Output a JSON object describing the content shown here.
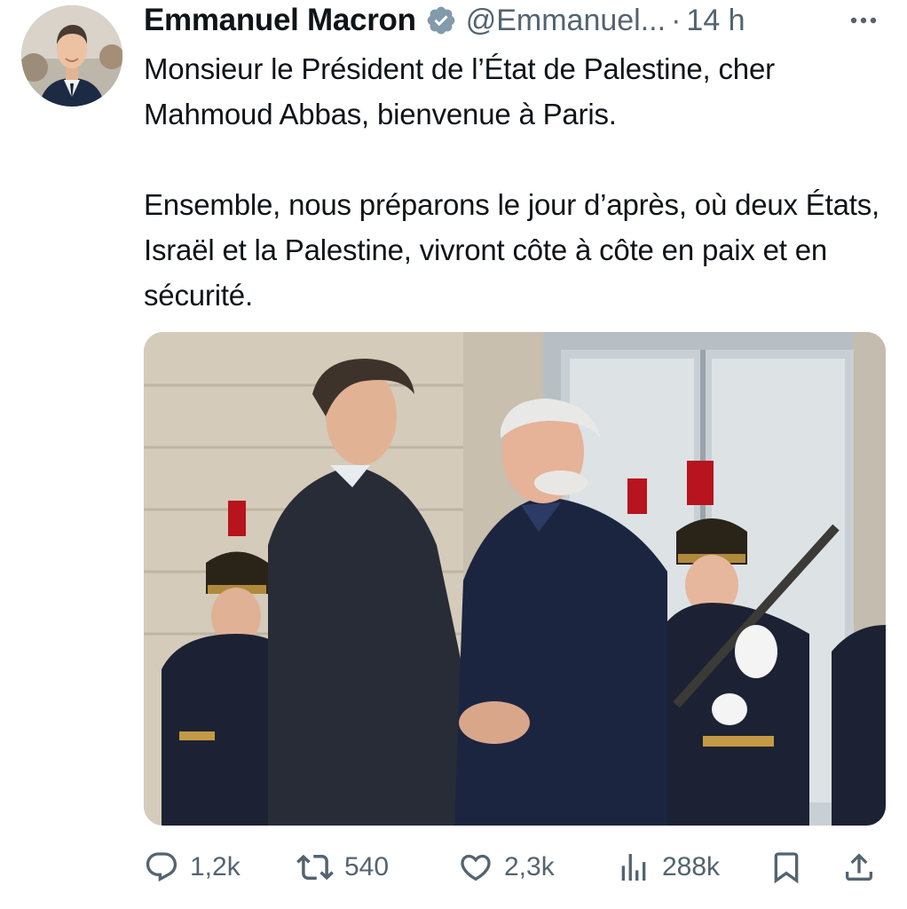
{
  "tweet": {
    "author": {
      "display_name": "Emmanuel Macron",
      "handle": "@Emmanuel...",
      "verified": true
    },
    "separator": "·",
    "time": "14 h",
    "paragraphs": [
      "Monsieur le Président de l’État de Palestine, cher Mahmoud Abbas, bienvenue à Paris.",
      "Ensemble, nous préparons le jour d’après, où deux États, Israël et la Palestine, vivront côte à côte en paix et en sécurité."
    ],
    "actions": {
      "reply_count": "1,2k",
      "retweet_count": "540",
      "like_count": "2,3k",
      "views_count": "288k"
    }
  },
  "icons": {
    "avatar": "avatar",
    "verified": "verified-badge-icon",
    "more": "more-icon",
    "reply": "reply-icon",
    "retweet": "retweet-icon",
    "like": "heart-icon",
    "views": "views-icon",
    "bookmark": "bookmark-icon",
    "share": "share-icon"
  },
  "colors": {
    "text": "#0f1419",
    "secondary": "#536471",
    "verified_badge": "#829aab"
  }
}
